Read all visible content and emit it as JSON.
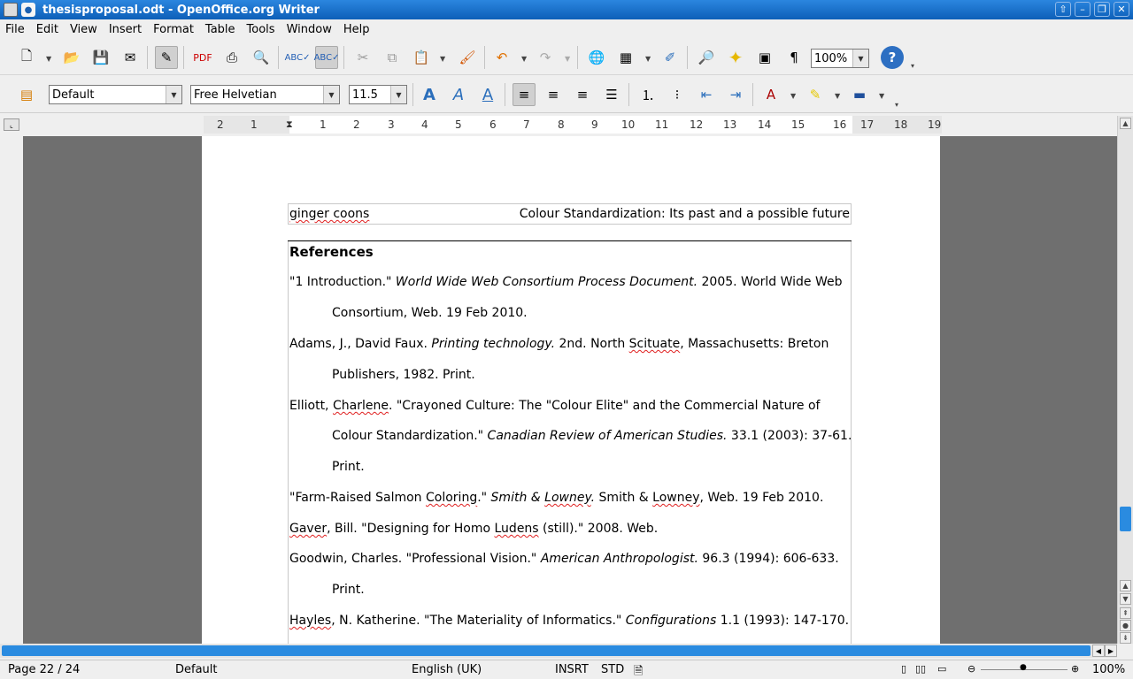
{
  "window": {
    "title": "thesisproposal.odt - OpenOffice.org Writer"
  },
  "menu": [
    "File",
    "Edit",
    "View",
    "Insert",
    "Format",
    "Table",
    "Tools",
    "Window",
    "Help"
  ],
  "toolbar": {
    "zoom": "100%"
  },
  "format_bar": {
    "style": "Default",
    "font": "Free Helvetian",
    "size": "11.5"
  },
  "ruler": {
    "numbers": [
      "2",
      "1",
      "",
      "1",
      "2",
      "3",
      "4",
      "5",
      "6",
      "7",
      "8",
      "9",
      "10",
      "11",
      "12",
      "13",
      "14",
      "15",
      "16",
      "17",
      "18",
      "19"
    ]
  },
  "document": {
    "header_left": "ginger coons",
    "header_right": "Colour Standardization: Its past and a possible future",
    "heading": "References",
    "l1a": "\"1 Introduction.\" ",
    "l1b": "World Wide Web Consortium Process Document.",
    "l1c": " 2005. World Wide Web",
    "l2": "Consortium,   Web. 19 Feb 2010.",
    "l3a": "Adams, J., David Faux. ",
    "l3b": "Printing technology.",
    "l3c": " 2nd. North ",
    "l3d": "Scituate",
    "l3e": ", Massachusetts: Breton",
    "l4": "Publishers, 1982. Print.",
    "l5a": "Elliott, ",
    "l5b": "Charlene",
    "l5c": ". \"Crayoned Culture: The \"Colour Elite\" and the Commercial Nature of",
    "l6a": "Colour Standardization.\" ",
    "l6b": "Canadian Review of American Studies.",
    "l6c": " 33.1 (2003): 37-61.",
    "l7": "Print.",
    "l8a": "\"Farm-Raised Salmon ",
    "l8b": "Coloring",
    "l8c": ".\" ",
    "l8d": "Smith & ",
    "l8e": "Lowney",
    "l8f": ".",
    "l8g": " Smith & ",
    "l8h": "Lowney",
    "l8i": ", Web. 19 Feb 2010.",
    "l9a": "Gaver",
    "l9b": ", Bill. \"Designing for Homo ",
    "l9c": "Ludens",
    "l9d": " (still).\" 2008. Web.",
    "l10a": "Goodwin, Charles. \"Professional Vision.\" ",
    "l10b": "American Anthropologist.",
    "l10c": " 96.3 (1994): 606-633.",
    "l11": "Print.",
    "l12a": "Hayles",
    "l12b": ", N. Katherine. \"The Materiality of Informatics.\" ",
    "l12c": "Configurations",
    "l12d": " 1.1 (1993): 147-170."
  },
  "status": {
    "page": "Page 22 / 24",
    "style": "Default",
    "language": "English (UK)",
    "insert": "INSRT",
    "selection": "STD",
    "zoom": "100%"
  }
}
